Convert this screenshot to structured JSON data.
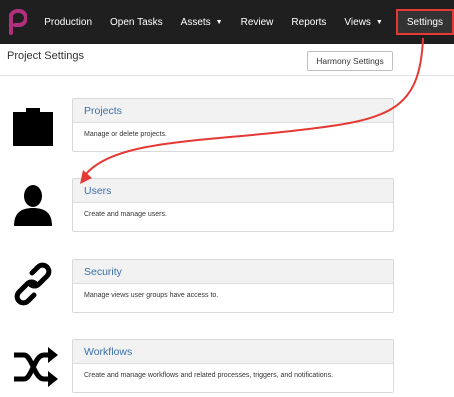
{
  "nav": {
    "items": [
      {
        "label": "Production"
      },
      {
        "label": "Open Tasks"
      },
      {
        "label": "Assets"
      },
      {
        "label": "Review"
      },
      {
        "label": "Reports"
      },
      {
        "label": "Views"
      }
    ],
    "settings_label": "Settings"
  },
  "header": {
    "title": "Project Settings",
    "harmony_button": "Harmony Settings"
  },
  "sections": [
    {
      "title": "Projects",
      "description": "Manage or delete projects.",
      "icon": "folder-icon"
    },
    {
      "title": "Users",
      "description": "Create and manage users.",
      "icon": "user-icon"
    },
    {
      "title": "Security",
      "description": "Manage views user groups have access to.",
      "icon": "link-icon"
    },
    {
      "title": "Workflows",
      "description": "Create and manage workflows and related processes, triggers, and notifications.",
      "icon": "shuffle-icon"
    }
  ],
  "colors": {
    "navbar": "#1f1f1f",
    "logo": "#b0307e",
    "highlight": "#e53935",
    "card_title": "#3a6fa8"
  }
}
